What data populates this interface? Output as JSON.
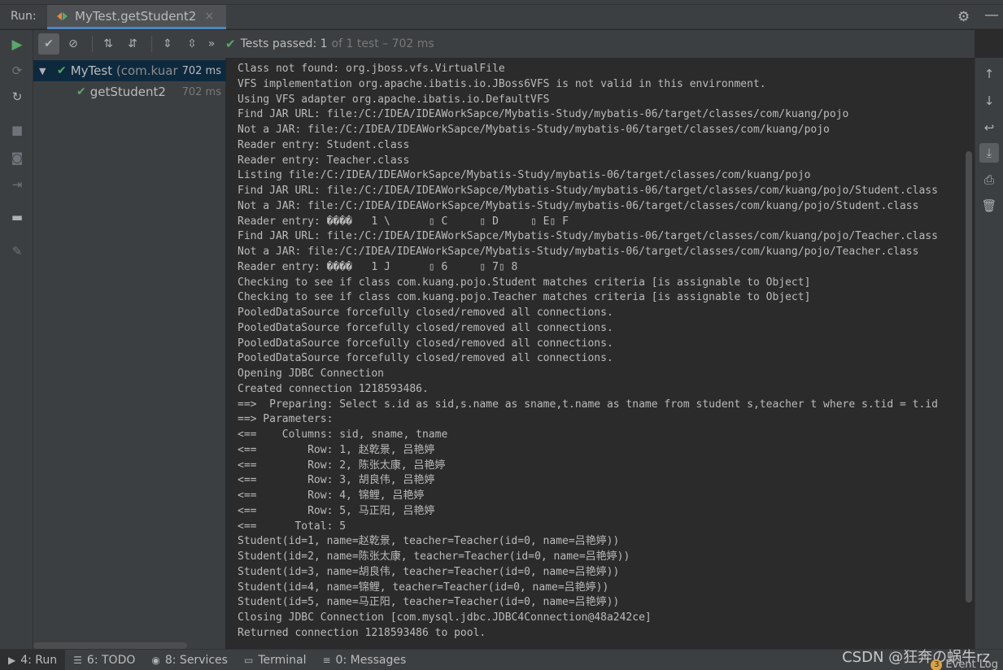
{
  "header": {
    "run_label": "Run:",
    "tab_title": "MyTest.getStudent2",
    "tab_close": "×",
    "settings_icon": "gear-icon",
    "minimize_icon": "minimize-icon"
  },
  "toolbar": {
    "status_main": "Tests passed: 1",
    "status_detail": "of 1 test – 702 ms",
    "more": "»"
  },
  "tree": {
    "root": {
      "name": "MyTest",
      "pkg": "(com.kuar",
      "time": "702 ms"
    },
    "child": {
      "name": "getStudent2",
      "time": "702 ms"
    }
  },
  "console": {
    "lines": [
      "Class not found: org.jboss.vfs.VirtualFile",
      "VFS implementation org.apache.ibatis.io.JBoss6VFS is not valid in this environment.",
      "Using VFS adapter org.apache.ibatis.io.DefaultVFS",
      "Find JAR URL: file:/C:/IDEA/IDEAWorkSapce/Mybatis-Study/mybatis-06/target/classes/com/kuang/pojo",
      "Not a JAR: file:/C:/IDEA/IDEAWorkSapce/Mybatis-Study/mybatis-06/target/classes/com/kuang/pojo",
      "Reader entry: Student.class",
      "Reader entry: Teacher.class",
      "Listing file:/C:/IDEA/IDEAWorkSapce/Mybatis-Study/mybatis-06/target/classes/com/kuang/pojo",
      "Find JAR URL: file:/C:/IDEA/IDEAWorkSapce/Mybatis-Study/mybatis-06/target/classes/com/kuang/pojo/Student.class",
      "Not a JAR: file:/C:/IDEA/IDEAWorkSapce/Mybatis-Study/mybatis-06/target/classes/com/kuang/pojo/Student.class",
      "Reader entry: ����   1 \\      ▯ C     ▯ D     ▯ E▯ F",
      "Find JAR URL: file:/C:/IDEA/IDEAWorkSapce/Mybatis-Study/mybatis-06/target/classes/com/kuang/pojo/Teacher.class",
      "Not a JAR: file:/C:/IDEA/IDEAWorkSapce/Mybatis-Study/mybatis-06/target/classes/com/kuang/pojo/Teacher.class",
      "Reader entry: ����   1 J      ▯ 6     ▯ 7▯ 8",
      "Checking to see if class com.kuang.pojo.Student matches criteria [is assignable to Object]",
      "Checking to see if class com.kuang.pojo.Teacher matches criteria [is assignable to Object]",
      "PooledDataSource forcefully closed/removed all connections.",
      "PooledDataSource forcefully closed/removed all connections.",
      "PooledDataSource forcefully closed/removed all connections.",
      "PooledDataSource forcefully closed/removed all connections.",
      "Opening JDBC Connection",
      "Created connection 1218593486.",
      "==>  Preparing: Select s.id as sid,s.name as sname,t.name as tname from student s,teacher t where s.tid = t.id",
      "==> Parameters: ",
      "<==    Columns: sid, sname, tname",
      "<==        Row: 1, 赵乾景, 吕艳婷",
      "<==        Row: 2, 陈张太康, 吕艳婷",
      "<==        Row: 3, 胡良伟, 吕艳婷",
      "<==        Row: 4, 锦鲤, 吕艳婷",
      "<==        Row: 5, 马正阳, 吕艳婷",
      "<==      Total: 5",
      "Student(id=1, name=赵乾景, teacher=Teacher(id=0, name=吕艳婷))",
      "Student(id=2, name=陈张太康, teacher=Teacher(id=0, name=吕艳婷))",
      "Student(id=3, name=胡良伟, teacher=Teacher(id=0, name=吕艳婷))",
      "Student(id=4, name=锦鲤, teacher=Teacher(id=0, name=吕艳婷))",
      "Student(id=5, name=马正阳, teacher=Teacher(id=0, name=吕艳婷))",
      "Closing JDBC Connection [com.mysql.jdbc.JDBC4Connection@48a242ce]",
      "Returned connection 1218593486 to pool."
    ]
  },
  "bottom": {
    "items": [
      {
        "label": "4: Run",
        "icon": "run-icon"
      },
      {
        "label": "6: TODO",
        "icon": "todo-icon"
      },
      {
        "label": "8: Services",
        "icon": "services-icon"
      },
      {
        "label": "Terminal",
        "icon": "terminal-icon"
      },
      {
        "label": "0: Messages",
        "icon": "messages-icon"
      }
    ],
    "watermark": "CSDN @狂奔の蜗牛rz",
    "event_log": "Event Log",
    "event_count": "3"
  },
  "colors": {
    "accent_green": "#59a869",
    "selection": "#0d293e",
    "panel": "#3c3f41",
    "editor": "#2b2b2b"
  }
}
